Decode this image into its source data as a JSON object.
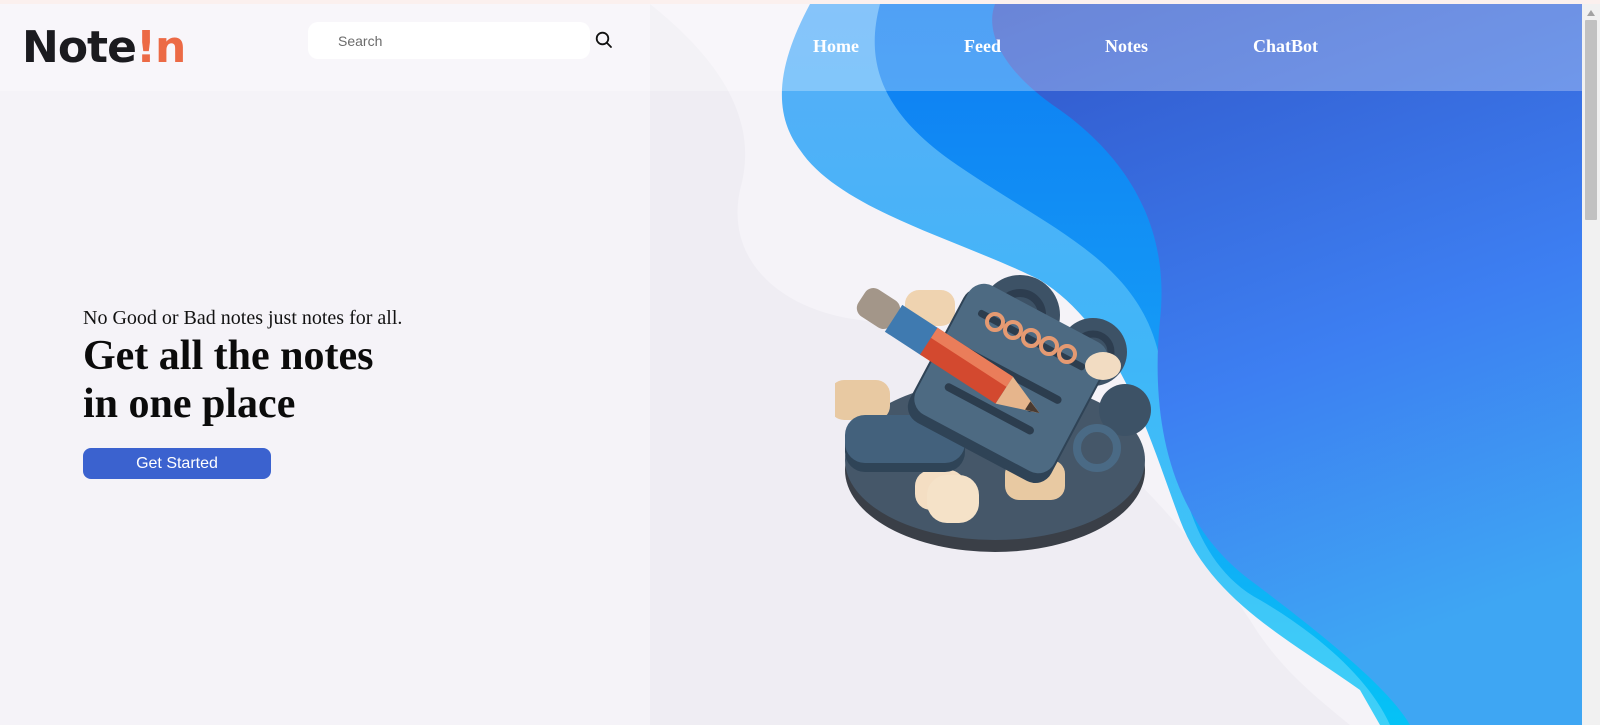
{
  "colors": {
    "background": "#f5f3f8",
    "accent": "#3b62cf",
    "logo_accent": "#ec6a45",
    "wave_dark": "#3458c9",
    "wave_light": "#1da2f5"
  },
  "header": {
    "logo": {
      "part1": "Note",
      "part2": "!",
      "part3": "n"
    },
    "search": {
      "placeholder": "Search",
      "icon": "search-icon"
    },
    "nav": [
      {
        "label": "Home"
      },
      {
        "label": "Feed"
      },
      {
        "label": "Notes"
      },
      {
        "label": "ChatBot"
      }
    ]
  },
  "hero": {
    "tagline": "No Good or Bad notes just notes for all.",
    "headline_line1": "Get all the notes",
    "headline_line2": "in one place",
    "cta_label": "Get Started",
    "illustration": "notebook-pencil-illustration"
  }
}
